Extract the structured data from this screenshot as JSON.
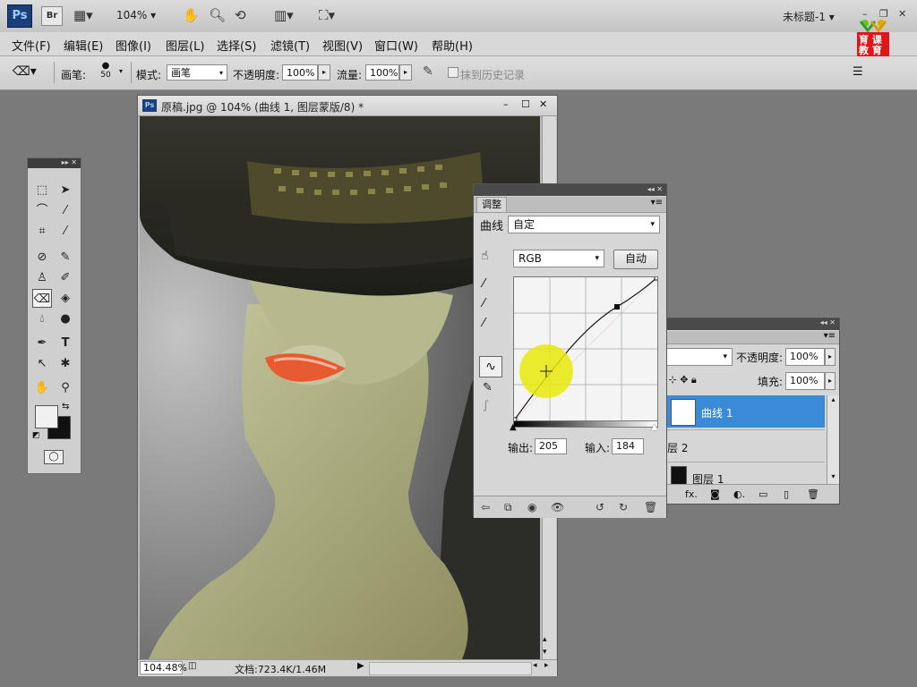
{
  "app": {
    "logo": "Ps",
    "bridge": "Br",
    "zoom": "104%",
    "window_title": "未标题-1"
  },
  "badge": {
    "line1": "育 课",
    "line2": "教 育"
  },
  "menu": [
    "文件(F)",
    "编辑(E)",
    "图像(I)",
    "图层(L)",
    "选择(S)",
    "滤镜(T)",
    "视图(V)",
    "窗口(W)",
    "帮助(H)"
  ],
  "options": {
    "brush_label": "画笔:",
    "brush_size": "50",
    "mode_label": "模式:",
    "mode_value": "画笔",
    "opacity_label": "不透明度:",
    "opacity_value": "100%",
    "flow_label": "流量:",
    "flow_value": "100%",
    "history_label": "抹到历史记录"
  },
  "document": {
    "title": "原稿.jpg @ 104% (曲线 1, 图层蒙版/8) *",
    "zoom": "104.48%",
    "doc_info": "文档:723.4K/1.46M"
  },
  "adjustments": {
    "tab": "调整",
    "curves_label": "曲线",
    "preset_value": "自定",
    "channel_value": "RGB",
    "auto_label": "自动",
    "output_label": "输出:",
    "output_value": "205",
    "input_label": "输入:",
    "input_value": "184"
  },
  "layers": {
    "opacity_label": "不透明度:",
    "opacity_value": "100%",
    "fill_label": "填充:",
    "fill_value": "100%",
    "rows": [
      {
        "name": "曲线 1"
      },
      {
        "name": "层 2"
      },
      {
        "name": "图层 1"
      }
    ]
  },
  "colors": {
    "accent": "#3a8ad8",
    "panel": "#d6d6d6",
    "workspace": "#7a7a7a",
    "highlight": "#e9e90a"
  }
}
